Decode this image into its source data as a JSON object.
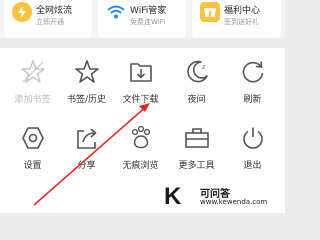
{
  "top_cards": [
    {
      "title": "全网炫流",
      "sub": "立即开通",
      "icon": "bolt-icon",
      "color": "#f6c343"
    },
    {
      "title": "WiFi管家",
      "sub": "免费连WiFi",
      "icon": "wifi-icon",
      "color": "#2a8cf0"
    },
    {
      "title": "福利中心",
      "sub": "签到送好礼",
      "icon": "gift-icon",
      "color": "#f6c343"
    }
  ],
  "grid": {
    "row1": [
      {
        "label": "添加书签",
        "icon": "star-outline-icon",
        "dim": true
      },
      {
        "label": "书签/历史",
        "icon": "star-icon",
        "dim": false
      },
      {
        "label": "文件下载",
        "icon": "download-folder-icon",
        "dim": false
      },
      {
        "label": "夜间",
        "icon": "moon-icon",
        "dim": false
      },
      {
        "label": "刷新",
        "icon": "refresh-icon",
        "dim": false
      }
    ],
    "row2": [
      {
        "label": "设置",
        "icon": "gear-hexagon-icon",
        "dim": false
      },
      {
        "label": "分享",
        "icon": "share-icon",
        "dim": false
      },
      {
        "label": "无痕浏览",
        "icon": "paw-icon",
        "dim": false
      },
      {
        "label": "更多工具",
        "icon": "toolbox-icon",
        "dim": false
      },
      {
        "label": "退出",
        "icon": "power-icon",
        "dim": false
      }
    ]
  },
  "watermark": {
    "logo": "K",
    "name": "可问答",
    "url": "www.kewenda.com"
  },
  "colors": {
    "accent_red": "#d9302c",
    "icon_gray": "#555555",
    "dim_gray": "#bbbbbb"
  }
}
